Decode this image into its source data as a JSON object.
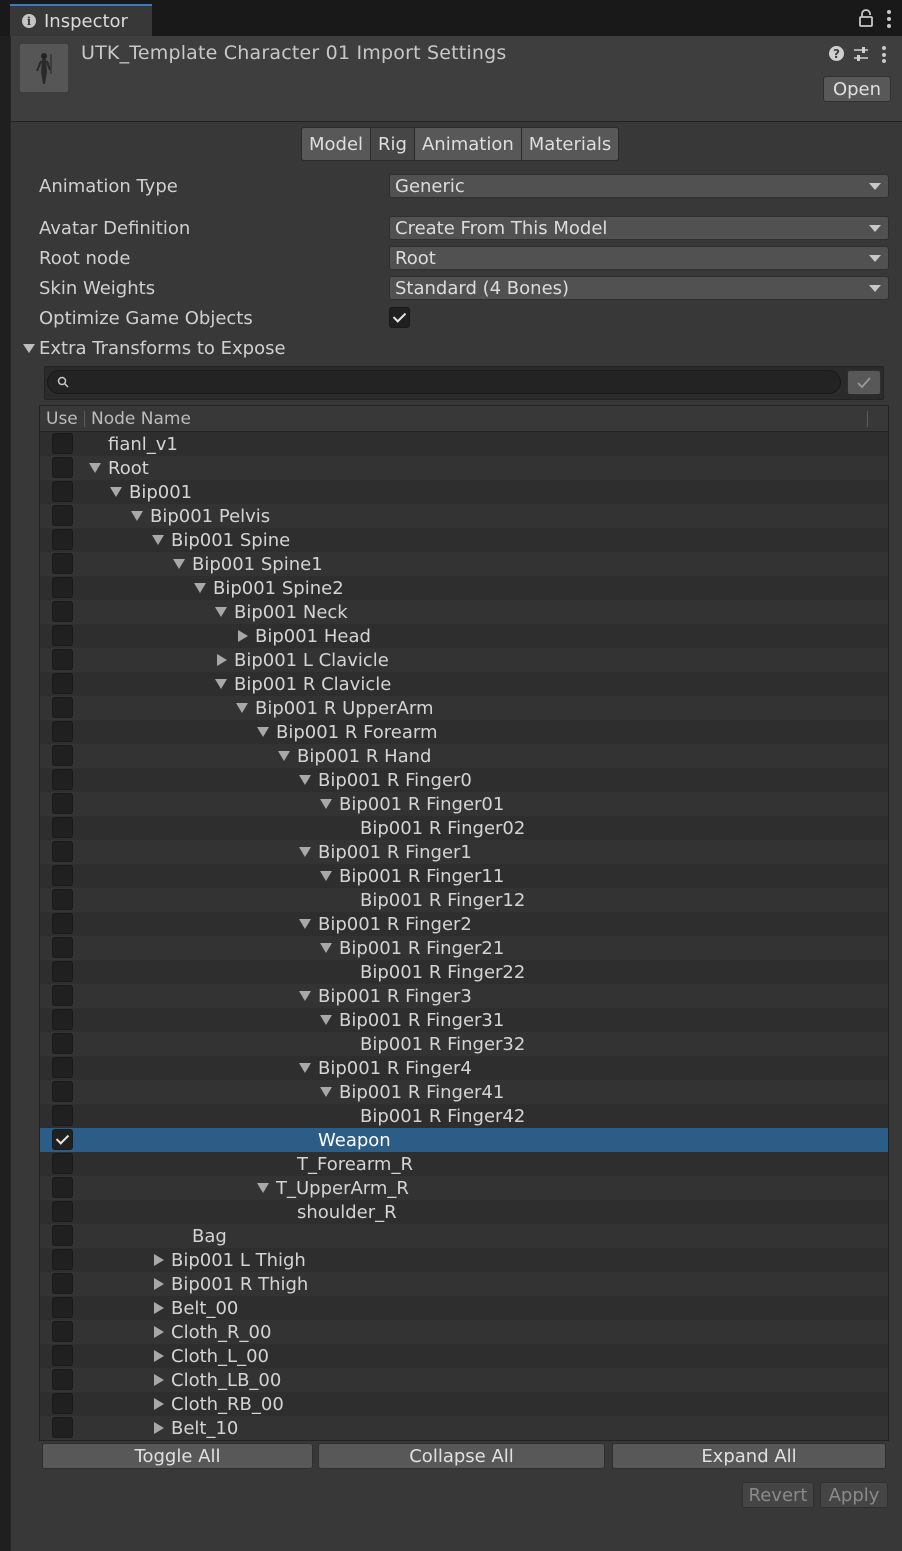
{
  "window": {
    "tab_label": "Inspector",
    "tab_icon": "info-icon",
    "lock_icon": "lock-icon",
    "menu_icon": "kebab-menu-icon"
  },
  "header": {
    "title": "UTK_Template Character 01 Import Settings",
    "thumbnail_icon": "character-model-icon",
    "help_icon": "help-icon",
    "preset_icon": "preset-sliders-icon",
    "open_label": "Open"
  },
  "tabs": [
    {
      "label": "Model",
      "active": false
    },
    {
      "label": "Rig",
      "active": true
    },
    {
      "label": "Animation",
      "active": false
    },
    {
      "label": "Materials",
      "active": false
    }
  ],
  "properties": {
    "animation_type": {
      "label": "Animation Type",
      "value": "Generic"
    },
    "avatar_definition": {
      "label": "Avatar Definition",
      "value": "Create From This Model"
    },
    "root_node": {
      "label": "Root node",
      "value": "Root"
    },
    "skin_weights": {
      "label": "Skin Weights",
      "value": "Standard (4 Bones)"
    },
    "optimize_game_objects": {
      "label": "Optimize Game Objects",
      "checked": true
    },
    "extra_transforms": {
      "label": "Extra Transforms to Expose",
      "expanded": true
    }
  },
  "search": {
    "value": "",
    "placeholder": ""
  },
  "tree": {
    "columns": {
      "use": "Use",
      "name": "Node Name"
    },
    "rows": [
      {
        "name": "fianl_v1",
        "depth": 0,
        "toggle": "none",
        "checked": false
      },
      {
        "name": "Root",
        "depth": 0,
        "toggle": "open",
        "checked": false
      },
      {
        "name": "Bip001",
        "depth": 1,
        "toggle": "open",
        "checked": false
      },
      {
        "name": "Bip001 Pelvis",
        "depth": 2,
        "toggle": "open",
        "checked": false
      },
      {
        "name": "Bip001 Spine",
        "depth": 3,
        "toggle": "open",
        "checked": false
      },
      {
        "name": "Bip001 Spine1",
        "depth": 4,
        "toggle": "open",
        "checked": false
      },
      {
        "name": "Bip001 Spine2",
        "depth": 5,
        "toggle": "open",
        "checked": false
      },
      {
        "name": "Bip001 Neck",
        "depth": 6,
        "toggle": "open",
        "checked": false
      },
      {
        "name": "Bip001 Head",
        "depth": 7,
        "toggle": "closed",
        "checked": false
      },
      {
        "name": "Bip001 L Clavicle",
        "depth": 6,
        "toggle": "closed",
        "checked": false
      },
      {
        "name": "Bip001 R Clavicle",
        "depth": 6,
        "toggle": "open",
        "checked": false
      },
      {
        "name": "Bip001 R UpperArm",
        "depth": 7,
        "toggle": "open",
        "checked": false
      },
      {
        "name": "Bip001 R Forearm",
        "depth": 8,
        "toggle": "open",
        "checked": false
      },
      {
        "name": "Bip001 R Hand",
        "depth": 9,
        "toggle": "open",
        "checked": false
      },
      {
        "name": "Bip001 R Finger0",
        "depth": 10,
        "toggle": "open",
        "checked": false
      },
      {
        "name": "Bip001 R Finger01",
        "depth": 11,
        "toggle": "open",
        "checked": false
      },
      {
        "name": "Bip001 R Finger02",
        "depth": 12,
        "toggle": "none",
        "checked": false
      },
      {
        "name": "Bip001 R Finger1",
        "depth": 10,
        "toggle": "open",
        "checked": false
      },
      {
        "name": "Bip001 R Finger11",
        "depth": 11,
        "toggle": "open",
        "checked": false
      },
      {
        "name": "Bip001 R Finger12",
        "depth": 12,
        "toggle": "none",
        "checked": false
      },
      {
        "name": "Bip001 R Finger2",
        "depth": 10,
        "toggle": "open",
        "checked": false
      },
      {
        "name": "Bip001 R Finger21",
        "depth": 11,
        "toggle": "open",
        "checked": false
      },
      {
        "name": "Bip001 R Finger22",
        "depth": 12,
        "toggle": "none",
        "checked": false
      },
      {
        "name": "Bip001 R Finger3",
        "depth": 10,
        "toggle": "open",
        "checked": false
      },
      {
        "name": "Bip001 R Finger31",
        "depth": 11,
        "toggle": "open",
        "checked": false
      },
      {
        "name": "Bip001 R Finger32",
        "depth": 12,
        "toggle": "none",
        "checked": false
      },
      {
        "name": "Bip001 R Finger4",
        "depth": 10,
        "toggle": "open",
        "checked": false
      },
      {
        "name": "Bip001 R Finger41",
        "depth": 11,
        "toggle": "open",
        "checked": false
      },
      {
        "name": "Bip001 R Finger42",
        "depth": 12,
        "toggle": "none",
        "checked": false
      },
      {
        "name": "Weapon",
        "depth": 10,
        "toggle": "none",
        "checked": true,
        "selected": true
      },
      {
        "name": "T_Forearm_R",
        "depth": 9,
        "toggle": "none",
        "checked": false
      },
      {
        "name": "T_UpperArm_R",
        "depth": 8,
        "toggle": "open",
        "checked": false
      },
      {
        "name": "shoulder_R",
        "depth": 9,
        "toggle": "none",
        "checked": false
      },
      {
        "name": "Bag",
        "depth": 4,
        "toggle": "none",
        "checked": false
      },
      {
        "name": "Bip001 L Thigh",
        "depth": 3,
        "toggle": "closed",
        "checked": false
      },
      {
        "name": "Bip001 R Thigh",
        "depth": 3,
        "toggle": "closed",
        "checked": false
      },
      {
        "name": "Belt_00",
        "depth": 3,
        "toggle": "closed",
        "checked": false
      },
      {
        "name": "Cloth_R_00",
        "depth": 3,
        "toggle": "closed",
        "checked": false
      },
      {
        "name": "Cloth_L_00",
        "depth": 3,
        "toggle": "closed",
        "checked": false
      },
      {
        "name": "Cloth_LB_00",
        "depth": 3,
        "toggle": "closed",
        "checked": false
      },
      {
        "name": "Cloth_RB_00",
        "depth": 3,
        "toggle": "closed",
        "checked": false
      },
      {
        "name": "Belt_10",
        "depth": 3,
        "toggle": "closed",
        "checked": false
      }
    ]
  },
  "buttons": {
    "toggle_all": "Toggle All",
    "collapse_all": "Collapse All",
    "expand_all": "Expand All",
    "revert": "Revert",
    "apply": "Apply"
  }
}
